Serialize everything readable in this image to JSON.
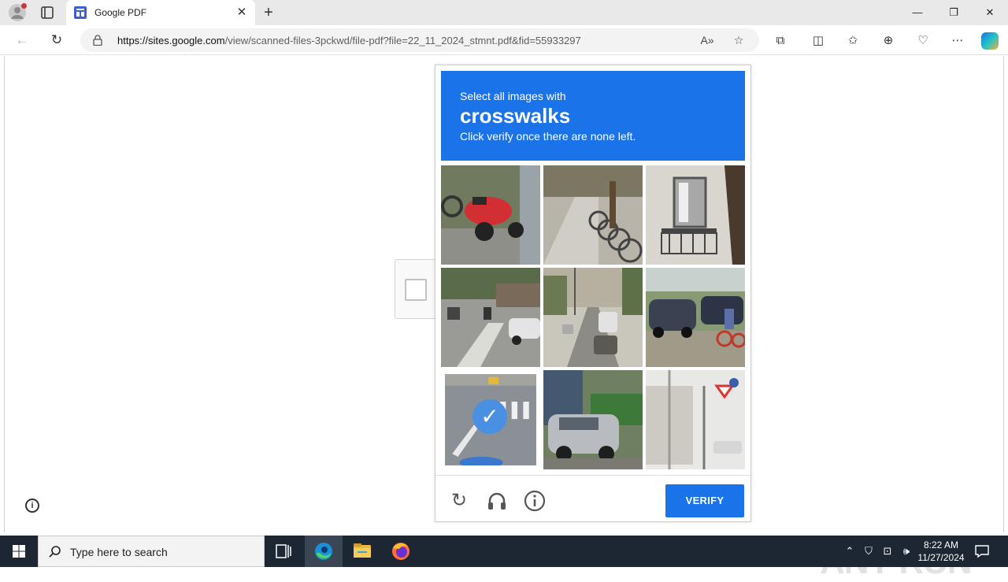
{
  "browser": {
    "tab_title": "Google PDF",
    "url_host": "https://sites.google.com",
    "url_path": "/view/scanned-files-3pckwd/file-pdf?file=22_11_2024_stmnt.pdf&fid=55933297",
    "accent_color": "#1a73e8"
  },
  "captcha": {
    "header_line1": "Select all images with",
    "header_keyword": "crosswalks",
    "header_line3": "Click verify once there are none left.",
    "tiles": [
      {
        "label": "red scooter parked on sidewalk",
        "selected": false
      },
      {
        "label": "row of parked bicycles",
        "selected": false
      },
      {
        "label": "building balcony",
        "selected": false
      },
      {
        "label": "street intersection with cars",
        "selected": false
      },
      {
        "label": "multi-lane road with traffic",
        "selected": false
      },
      {
        "label": "cars and cyclist on paved lot",
        "selected": false
      },
      {
        "label": "road with crosswalk markings",
        "selected": true
      },
      {
        "label": "silver car next to green truck",
        "selected": false
      },
      {
        "label": "street corner with yield sign",
        "selected": false
      }
    ],
    "verify_label": "VERIFY",
    "footer_icons": [
      "reload-icon",
      "audio-icon",
      "info-icon"
    ]
  },
  "watermark": "ANY RUN",
  "taskbar": {
    "search_placeholder": "Type here to search",
    "time": "8:22 AM",
    "date": "11/27/2024"
  }
}
